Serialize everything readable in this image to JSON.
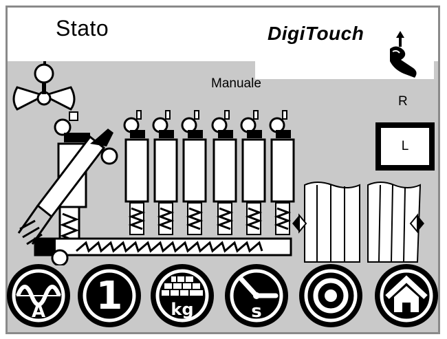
{
  "header": {
    "title": "Stato",
    "logo_text": "DigiTouch",
    "logo_icon": "hand-touch-icon"
  },
  "status": {
    "mode": "Manuale",
    "side_r": "R",
    "side_l": "L"
  },
  "toolbar": [
    {
      "name": "power-a-button",
      "icon": "sine-wave-icon",
      "label": "A"
    },
    {
      "name": "step-1-button",
      "icon": "number-one-icon",
      "label": "1"
    },
    {
      "name": "weight-kg-button",
      "icon": "bricks-weight-icon",
      "label": "kg"
    },
    {
      "name": "time-s-button",
      "icon": "clock-hands-icon",
      "label": "s"
    },
    {
      "name": "target-button",
      "icon": "target-ring-icon",
      "label": ""
    },
    {
      "name": "home-button",
      "icon": "home-icon",
      "label": ""
    }
  ],
  "colors": {
    "panel_bg": "#c9c9c9",
    "frame_border": "#8a8a8a",
    "foreground": "#000000",
    "machine_fill": "#ffffff"
  }
}
